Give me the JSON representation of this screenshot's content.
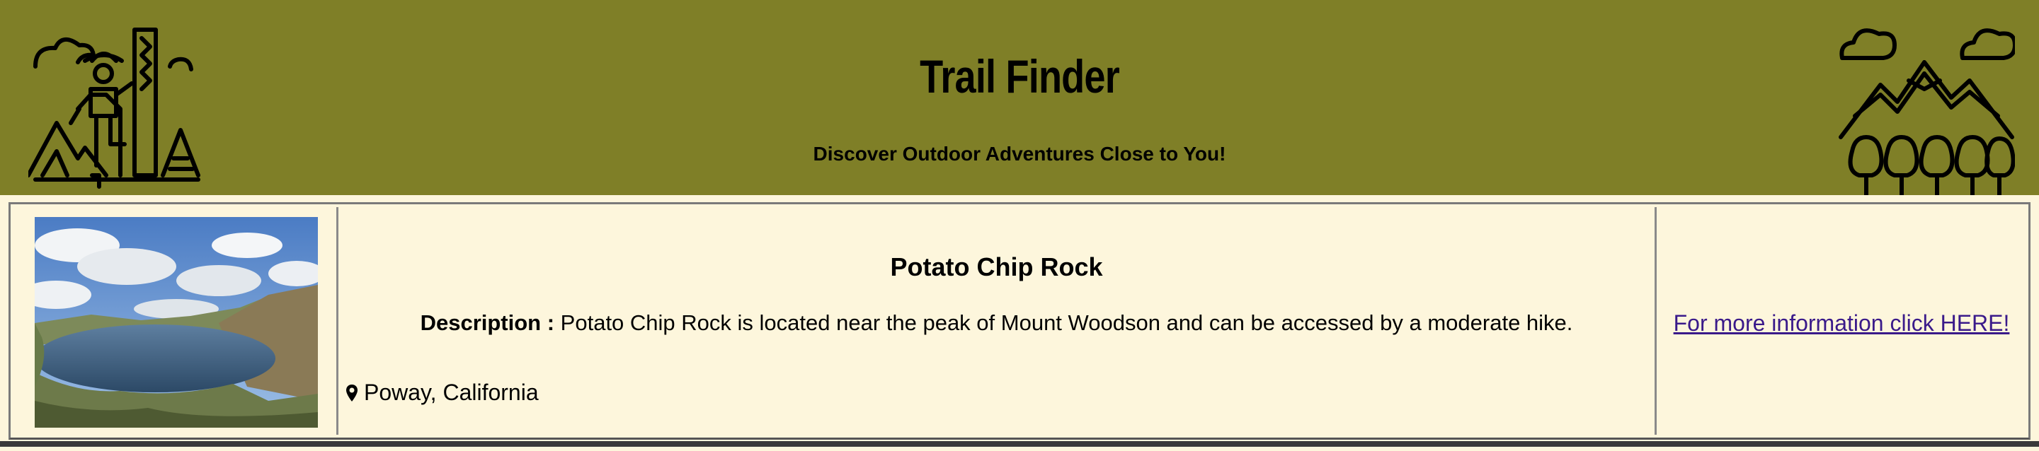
{
  "header": {
    "title": "Trail Finder",
    "tagline": "Discover Outdoor Adventures Close to You!",
    "left_logo_icon": "hiker-climbing-icon",
    "right_logo_icon": "mountains-forest-icon",
    "background_color": "#7f7f27"
  },
  "trail": {
    "name": "Potato Chip Rock",
    "description_label": "Description :",
    "description_text": "Potato Chip Rock is located near the peak of Mount Woodson and can be accessed by a moderate hike.",
    "location_icon": "map-marker-icon",
    "location": "Poway, California",
    "link_text": "For more information click HERE!",
    "photo_icon": "lake-landscape-photo"
  },
  "colors": {
    "page_background": "#fdf6dc",
    "link": "#3a1a8a"
  }
}
